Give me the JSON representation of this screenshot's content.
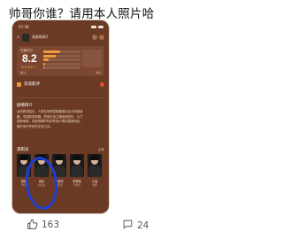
{
  "post": {
    "text": "帅哥你谁？请用本人照片哈"
  },
  "screenshot": {
    "status_time": "07:58",
    "header_title": "流浪地球2",
    "rating_label": "豆瓣评分",
    "score": "8.2",
    "stars": "★★★★☆",
    "distribution": [
      0.45,
      0.33,
      0.15,
      0.05,
      0.02
    ],
    "card_footer_left": "看过",
    "card_footer_right": "详情",
    "fan_label": "流浪影评",
    "synopsis_title": "剧情简介",
    "synopsis_lines": [
      "太阳即将毁灭，人类在地球表面建造出巨大的推进",
      "器，寻找新的家园。然而宇宙之路危机四伏，为了",
      "拯救地球，流浪地球时代的年轻人再次挺身而出，",
      "展开争分夺秒的生死之战。"
    ],
    "cast_title": "演职员",
    "cast_more": "全部",
    "cast": [
      {
        "name": "郭帆",
        "role": "导演"
      },
      {
        "name": "吴京",
        "role": "刘培强"
      },
      {
        "name": "刘德华",
        "role": "图恒宇"
      },
      {
        "name": "李雪健",
        "role": "周喆直"
      },
      {
        "name": "沙溢",
        "role": "张鹏"
      }
    ]
  },
  "actions": {
    "like_count": "163",
    "comment_count": "24"
  },
  "colors": {
    "annotation_circle": "#1f3fd6",
    "phone_bg": "#6b3a24"
  }
}
